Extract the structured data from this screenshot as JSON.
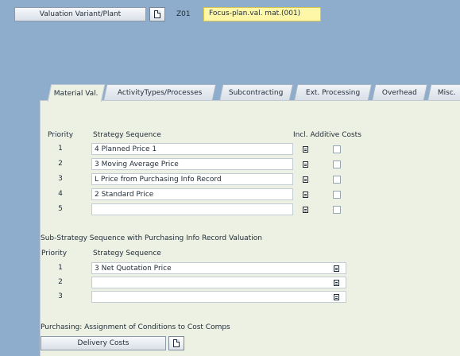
{
  "header": {
    "valuation_variant_label": "Valuation Variant/Plant",
    "code": "Z01",
    "description": "Focus-plan.val. mat.(001)"
  },
  "tabs": [
    {
      "label": "Material Val."
    },
    {
      "label": "ActivityTypes/Processes"
    },
    {
      "label": "Subcontracting"
    },
    {
      "label": "Ext. Processing"
    },
    {
      "label": "Overhead"
    },
    {
      "label": "Misc."
    }
  ],
  "strategy": {
    "col_priority": "Priority",
    "col_sequence": "Strategy Sequence",
    "col_incl": "Incl. Additive Costs",
    "rows": [
      {
        "priority": "1",
        "sequence": "4 Planned Price 1",
        "checked": false
      },
      {
        "priority": "2",
        "sequence": "3 Moving Average Price",
        "checked": false
      },
      {
        "priority": "3",
        "sequence": "L Price from Purchasing Info Record",
        "checked": false
      },
      {
        "priority": "4",
        "sequence": "2 Standard Price",
        "checked": false
      },
      {
        "priority": "5",
        "sequence": "",
        "checked": false
      }
    ]
  },
  "substrategy": {
    "title": "Sub-Strategy Sequence with Purchasing Info Record Valuation",
    "col_priority": "Priority",
    "col_sequence": "Strategy Sequence",
    "rows": [
      {
        "priority": "1",
        "sequence": "3 Net Quotation Price"
      },
      {
        "priority": "2",
        "sequence": ""
      },
      {
        "priority": "3",
        "sequence": ""
      }
    ]
  },
  "purchasing": {
    "title": "Purchasing: Assignment of Conditions to Cost Comps",
    "delivery_costs_label": "Delivery Costs"
  },
  "colors": {
    "background": "#8eaccb",
    "panel": "#edf1e4",
    "highlight": "#fff7a8"
  }
}
